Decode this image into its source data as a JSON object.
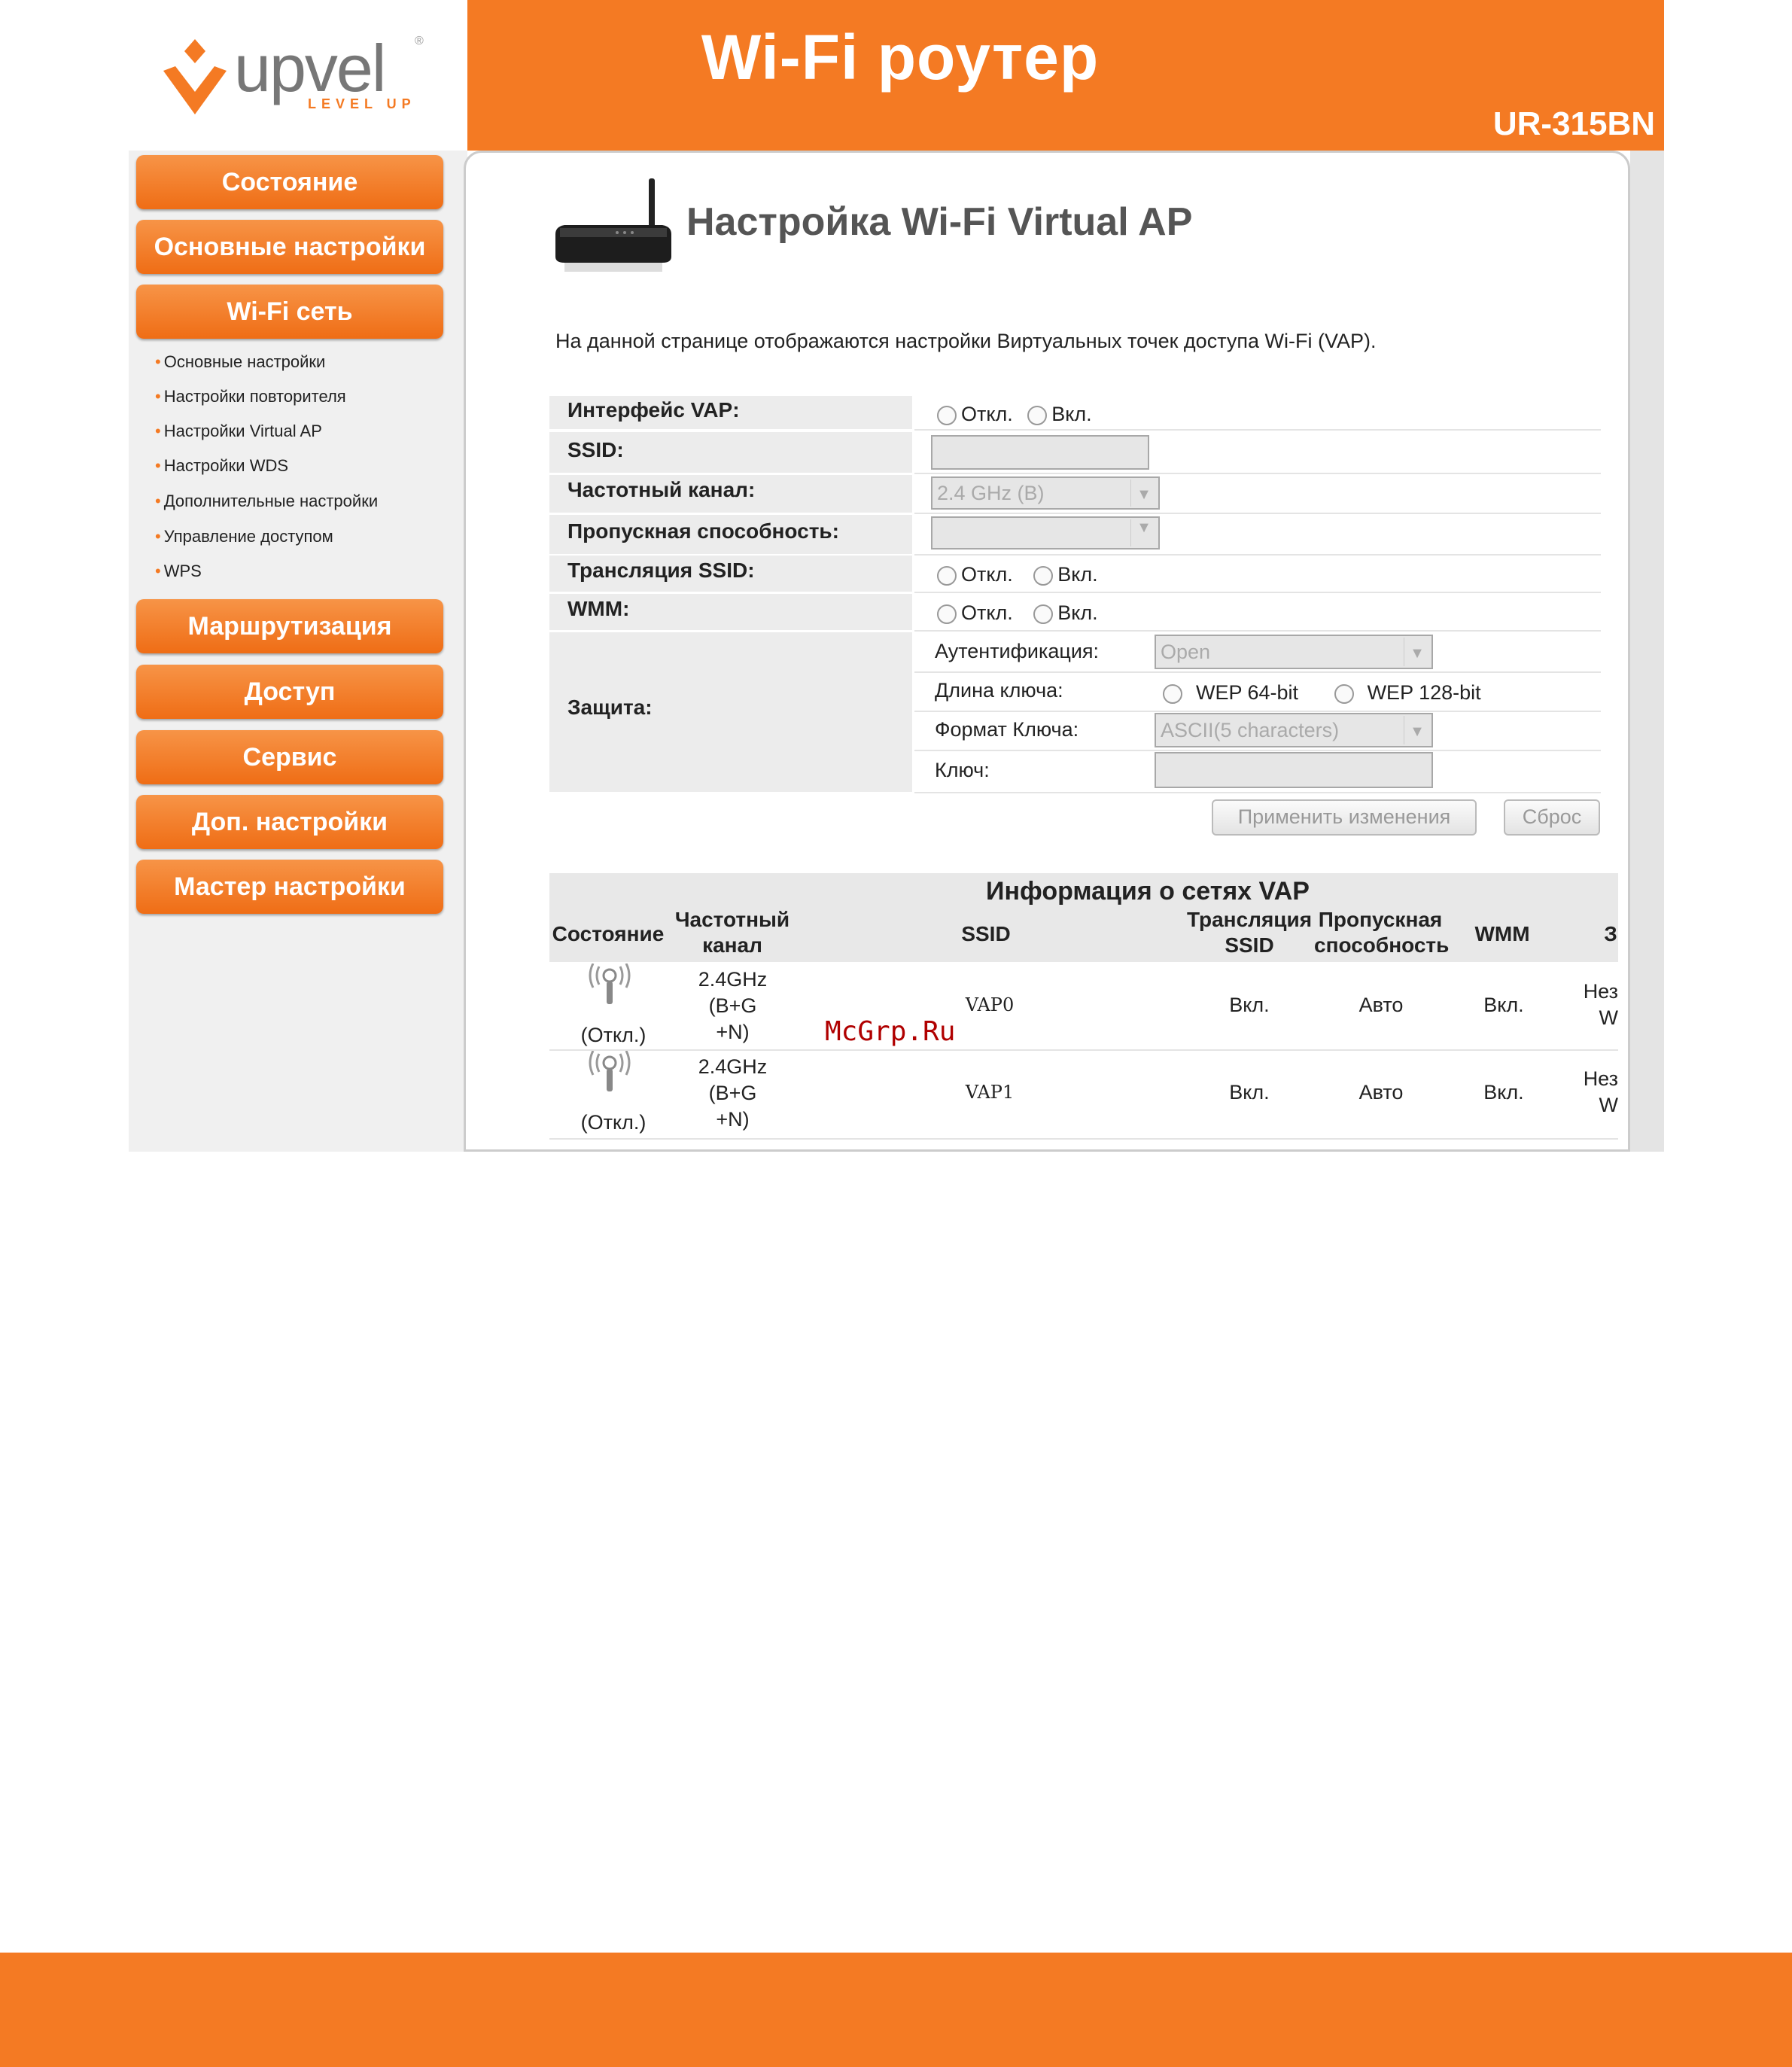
{
  "header": {
    "logo_text": "upvel",
    "logo_tagline": "LEVEL UP",
    "logo_reg": "®",
    "title": "Wi-Fi роутер",
    "model": "UR-315BN"
  },
  "sidebar": {
    "menu_top": [
      "Состояние",
      "Основные настройки",
      "Wi-Fi сеть"
    ],
    "submenu": [
      "Основные настройки",
      "Настройки повторителя",
      "Настройки Virtual AP",
      "Настройки WDS",
      "Дополнительные настройки",
      "Управление доступом",
      "WPS"
    ],
    "menu_bottom": [
      "Маршрутизация",
      "Доступ",
      "Сервис",
      "Доп. настройки",
      "Мастер настройки"
    ]
  },
  "page": {
    "title": "Настройка Wi-Fi Virtual AP",
    "description": "На данной странице отображаются настройки Виртуальных точек доступа Wi-Fi (VAP)."
  },
  "form": {
    "vap_interface_label": "Интерфейс VAP:",
    "ssid_label": "SSID:",
    "channel_label": "Частотный канал:",
    "channel_value": "2.4 GHz (B)",
    "bandwidth_label": "Пропускная способность:",
    "broadcast_label": "Трансляция SSID:",
    "wmm_label": "WMM:",
    "off": "Откл.",
    "on": "Вкл.",
    "security_label": "Защита:",
    "auth_label": "Аутентификация:",
    "auth_value": "Open",
    "key_length_label": "Длина ключа:",
    "wep64": "WEP 64-bit",
    "wep128": "WEP 128-bit",
    "key_format_label": "Формат Ключа:",
    "key_format_value": "ASCII(5 characters)",
    "key_label": "Ключ:",
    "apply_button": "Применить изменения",
    "reset_button": "Сброс"
  },
  "table": {
    "title": "Информация о сетях VAP",
    "headers": [
      "Состояние",
      "Частотный канал",
      "SSID",
      "Трансляция SSID",
      "Пропускная способность",
      "WMM",
      "З"
    ],
    "rows": [
      {
        "status": "(Откл.)",
        "channel": [
          "2.4GHz",
          "(B+G",
          "+N)"
        ],
        "ssid": "VAP0",
        "broadcast": "Вкл.",
        "bandwidth": "Авто",
        "wmm": "Вкл.",
        "security": [
          "Нез",
          "W"
        ]
      },
      {
        "status": "(Откл.)",
        "channel": [
          "2.4GHz",
          "(B+G",
          "+N)"
        ],
        "ssid": "VAP1",
        "broadcast": "Вкл.",
        "bandwidth": "Авто",
        "wmm": "Вкл.",
        "security": [
          "Нез",
          "W"
        ]
      }
    ]
  },
  "watermark": "McGrp.Ru",
  "colors": {
    "brand_orange": "#f47a23",
    "sidebar_bg": "#f0f0f0",
    "label_bg": "#ececec"
  }
}
